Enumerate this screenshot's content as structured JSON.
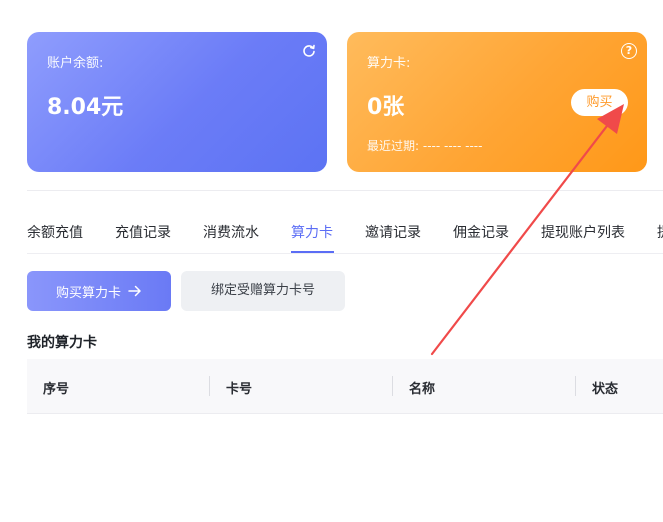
{
  "balance_card": {
    "label": "账户余额:",
    "value": "8.04元",
    "refresh_icon": "refresh-icon"
  },
  "compute_card": {
    "label": "算力卡:",
    "value": "0张",
    "buy_label": "购买",
    "expiry": "最近过期: ---- ---- ----",
    "help_symbol": "?"
  },
  "tabs": [
    {
      "label": "余额充值"
    },
    {
      "label": "充值记录"
    },
    {
      "label": "消费流水"
    },
    {
      "label": "算力卡",
      "active": true
    },
    {
      "label": "邀请记录"
    },
    {
      "label": "佣金记录"
    },
    {
      "label": "提现账户列表"
    },
    {
      "label": "提"
    }
  ],
  "actions": {
    "buy_card_label": "购买算力卡",
    "bind_card_label": "绑定受赠算力卡号"
  },
  "section_title": "我的算力卡",
  "table": {
    "columns": [
      "序号",
      "卡号",
      "名称",
      "状态"
    ]
  },
  "colors": {
    "accent": "#5b6df5",
    "balance_card": "#6b7cf7",
    "compute_card": "#ffa534",
    "annotation_arrow": "#f04a4a"
  }
}
